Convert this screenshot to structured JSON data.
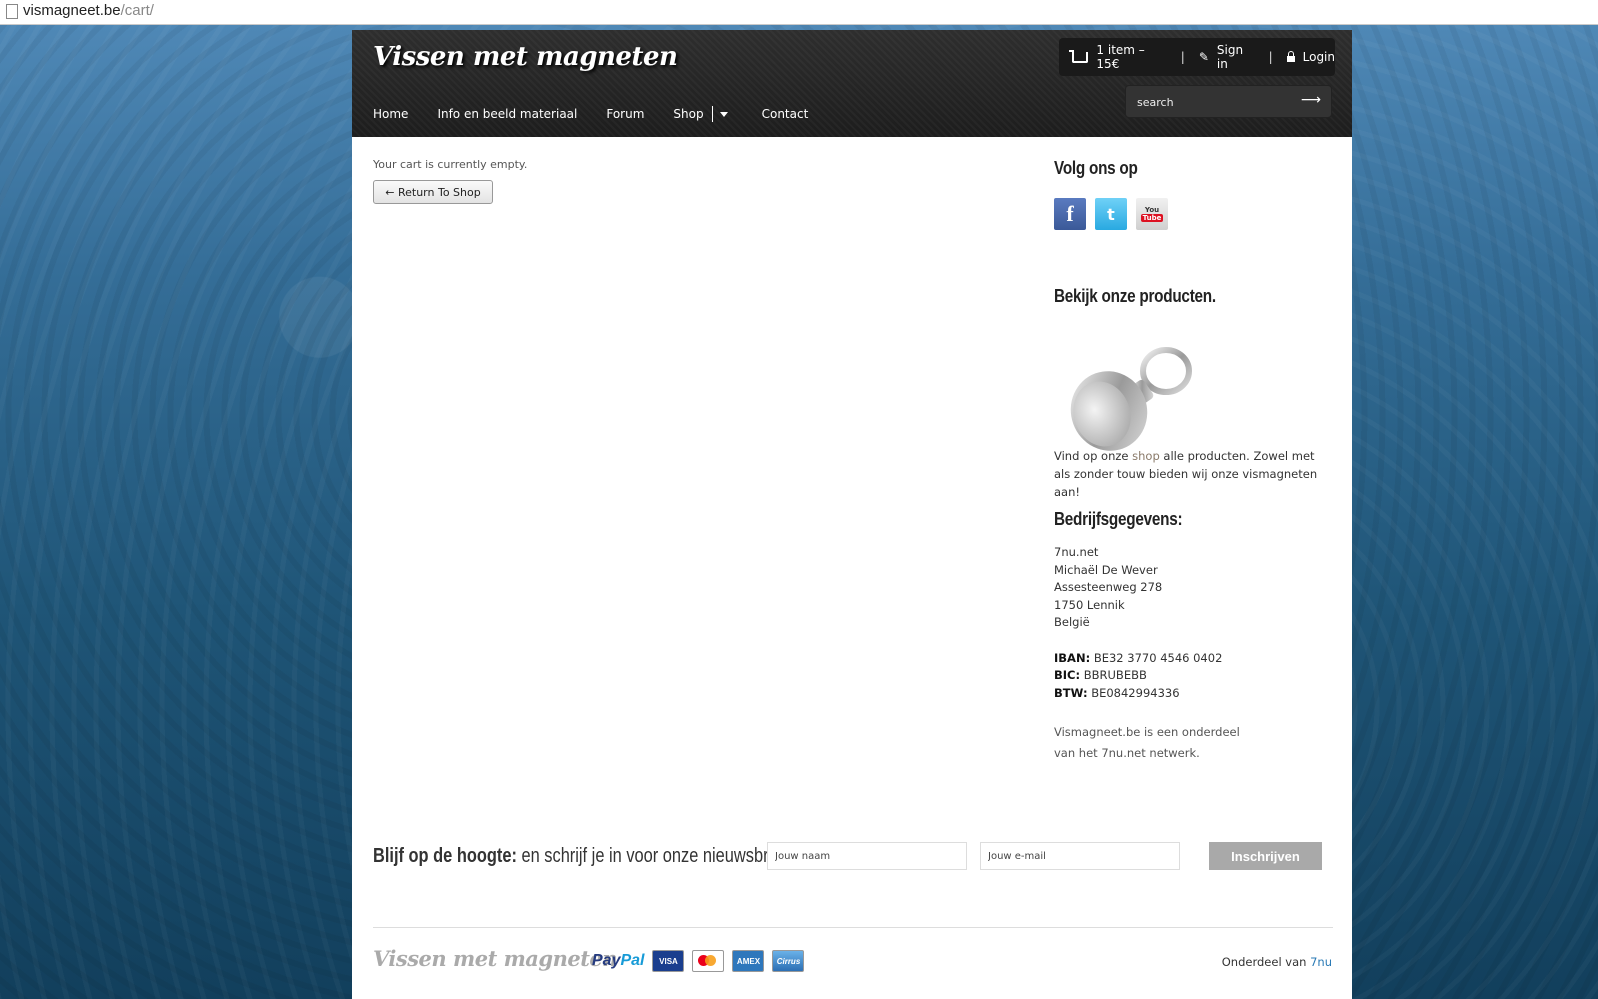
{
  "browser": {
    "url_host": "vismagneet.be",
    "url_path": "/cart/"
  },
  "header": {
    "logo": "Vissen met magneten",
    "nav": [
      "Home",
      "Info en beeld materiaal",
      "Forum",
      "Shop",
      "Contact"
    ],
    "cart_summary": "1 item – 15€",
    "sign_in": "Sign in",
    "login": "Login",
    "search_placeholder": "search",
    "search_go": "⟶"
  },
  "main": {
    "empty_message": "Your cart is currently empty.",
    "return_button": "← Return To Shop"
  },
  "sidebar": {
    "follow_title": "Volg ons op",
    "social": {
      "facebook": "f",
      "twitter": "t",
      "youtube_top": "You",
      "youtube_bottom": "Tube"
    },
    "products_title": "Bekijk onze producten.",
    "desc_before": "Vind op onze ",
    "desc_link": "shop",
    "desc_after": " alle producten. Zowel met als zonder touw bieden wij onze vismagneten aan!",
    "company_title": "Bedrijfsgegevens:",
    "company_lines": [
      "7nu.net",
      "Michaël De Wever",
      "Assesteenweg 278",
      "1750 Lennik",
      "België"
    ],
    "iban_label": "IBAN:",
    "iban": "BE32 3770 4546 0402",
    "bic_label": "BIC:",
    "bic": "BBRUBEBB",
    "btw_label": "BTW:",
    "btw": "BE0842994336",
    "network_line1": "Vismagneet.be is een onderdeel",
    "network_line2": "van het 7nu.net netwerk."
  },
  "newsletter": {
    "title_bold": "Blijf op de hoogte:",
    "title_rest": " en schrijf je in voor onze nieuwsbrief",
    "name_placeholder": "Jouw naam",
    "email_placeholder": "Jouw e-mail",
    "button": "Inschrijven"
  },
  "footer": {
    "logo": "Vissen met magneten",
    "paypal_a": "Pay",
    "paypal_b": "Pal",
    "visa": "VISA",
    "amex": "AMEX",
    "cirrus": "Cirrus",
    "part_of": "Onderdeel van ",
    "brand": "7nu"
  }
}
